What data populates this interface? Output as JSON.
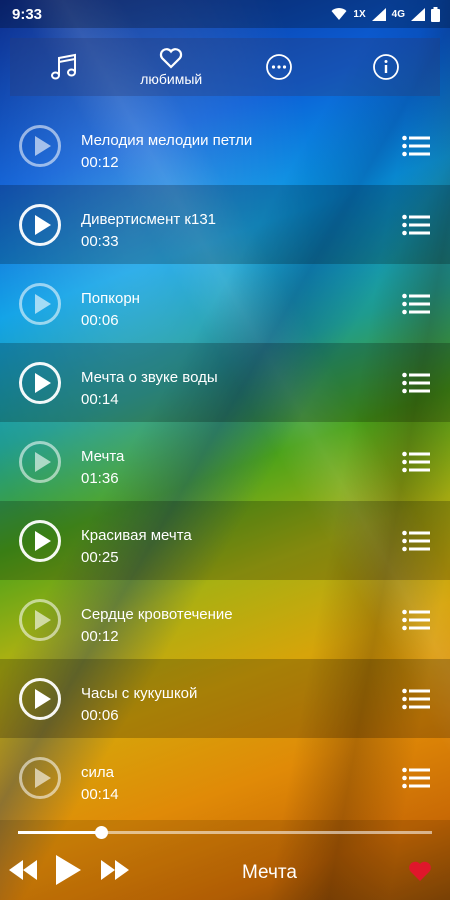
{
  "status_bar": {
    "time": "9:33",
    "network_badge": "1X",
    "network_type": "4G",
    "icons": [
      "wifi-icon",
      "signal-icon",
      "battery-icon"
    ]
  },
  "tabs": [
    {
      "name": "music-note-icon",
      "label": ""
    },
    {
      "name": "heart-outline-icon",
      "label": "любимый"
    },
    {
      "name": "more-icon",
      "label": ""
    },
    {
      "name": "info-icon",
      "label": ""
    }
  ],
  "tracks": [
    {
      "title": "Мелодия мелодии петли",
      "duration": "00:12"
    },
    {
      "title": "Дивертисмент к131",
      "duration": "00:33"
    },
    {
      "title": "Попкорн",
      "duration": "00:06"
    },
    {
      "title": "Мечта о звуке воды",
      "duration": "00:14"
    },
    {
      "title": "Мечта",
      "duration": "01:36"
    },
    {
      "title": "Красивая мечта",
      "duration": "00:25"
    },
    {
      "title": "Сердце кровотечение",
      "duration": "00:12"
    },
    {
      "title": "Часы с кукушкой",
      "duration": "00:06"
    },
    {
      "title": "сила",
      "duration": "00:14"
    }
  ],
  "player": {
    "now_playing": "Мечта",
    "progress": 0.2,
    "favorite_color": "#e0162b"
  }
}
